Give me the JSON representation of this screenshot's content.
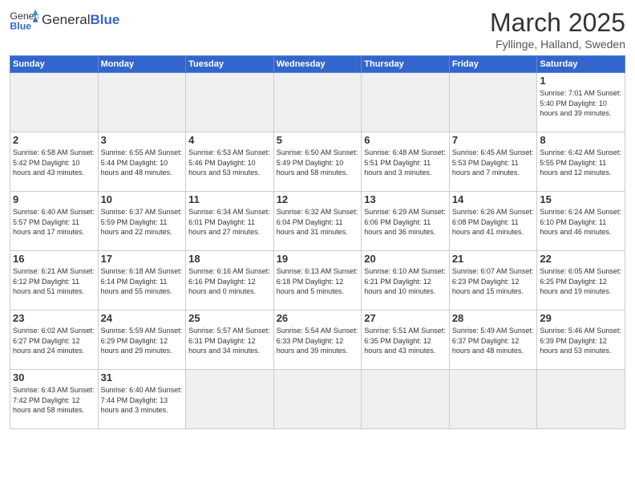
{
  "header": {
    "logo_general": "General",
    "logo_blue": "Blue",
    "month_title": "March 2025",
    "location": "Fyllinge, Halland, Sweden"
  },
  "days_of_week": [
    "Sunday",
    "Monday",
    "Tuesday",
    "Wednesday",
    "Thursday",
    "Friday",
    "Saturday"
  ],
  "weeks": [
    [
      {
        "day": "",
        "info": ""
      },
      {
        "day": "",
        "info": ""
      },
      {
        "day": "",
        "info": ""
      },
      {
        "day": "",
        "info": ""
      },
      {
        "day": "",
        "info": ""
      },
      {
        "day": "",
        "info": ""
      },
      {
        "day": "1",
        "info": "Sunrise: 7:01 AM\nSunset: 5:40 PM\nDaylight: 10 hours\nand 39 minutes."
      }
    ],
    [
      {
        "day": "2",
        "info": "Sunrise: 6:58 AM\nSunset: 5:42 PM\nDaylight: 10 hours\nand 43 minutes."
      },
      {
        "day": "3",
        "info": "Sunrise: 6:55 AM\nSunset: 5:44 PM\nDaylight: 10 hours\nand 48 minutes."
      },
      {
        "day": "4",
        "info": "Sunrise: 6:53 AM\nSunset: 5:46 PM\nDaylight: 10 hours\nand 53 minutes."
      },
      {
        "day": "5",
        "info": "Sunrise: 6:50 AM\nSunset: 5:49 PM\nDaylight: 10 hours\nand 58 minutes."
      },
      {
        "day": "6",
        "info": "Sunrise: 6:48 AM\nSunset: 5:51 PM\nDaylight: 11 hours\nand 3 minutes."
      },
      {
        "day": "7",
        "info": "Sunrise: 6:45 AM\nSunset: 5:53 PM\nDaylight: 11 hours\nand 7 minutes."
      },
      {
        "day": "8",
        "info": "Sunrise: 6:42 AM\nSunset: 5:55 PM\nDaylight: 11 hours\nand 12 minutes."
      }
    ],
    [
      {
        "day": "9",
        "info": "Sunrise: 6:40 AM\nSunset: 5:57 PM\nDaylight: 11 hours\nand 17 minutes."
      },
      {
        "day": "10",
        "info": "Sunrise: 6:37 AM\nSunset: 5:59 PM\nDaylight: 11 hours\nand 22 minutes."
      },
      {
        "day": "11",
        "info": "Sunrise: 6:34 AM\nSunset: 6:01 PM\nDaylight: 11 hours\nand 27 minutes."
      },
      {
        "day": "12",
        "info": "Sunrise: 6:32 AM\nSunset: 6:04 PM\nDaylight: 11 hours\nand 31 minutes."
      },
      {
        "day": "13",
        "info": "Sunrise: 6:29 AM\nSunset: 6:06 PM\nDaylight: 11 hours\nand 36 minutes."
      },
      {
        "day": "14",
        "info": "Sunrise: 6:26 AM\nSunset: 6:08 PM\nDaylight: 11 hours\nand 41 minutes."
      },
      {
        "day": "15",
        "info": "Sunrise: 6:24 AM\nSunset: 6:10 PM\nDaylight: 11 hours\nand 46 minutes."
      }
    ],
    [
      {
        "day": "16",
        "info": "Sunrise: 6:21 AM\nSunset: 6:12 PM\nDaylight: 11 hours\nand 51 minutes."
      },
      {
        "day": "17",
        "info": "Sunrise: 6:18 AM\nSunset: 6:14 PM\nDaylight: 11 hours\nand 55 minutes."
      },
      {
        "day": "18",
        "info": "Sunrise: 6:16 AM\nSunset: 6:16 PM\nDaylight: 12 hours\nand 0 minutes."
      },
      {
        "day": "19",
        "info": "Sunrise: 6:13 AM\nSunset: 6:18 PM\nDaylight: 12 hours\nand 5 minutes."
      },
      {
        "day": "20",
        "info": "Sunrise: 6:10 AM\nSunset: 6:21 PM\nDaylight: 12 hours\nand 10 minutes."
      },
      {
        "day": "21",
        "info": "Sunrise: 6:07 AM\nSunset: 6:23 PM\nDaylight: 12 hours\nand 15 minutes."
      },
      {
        "day": "22",
        "info": "Sunrise: 6:05 AM\nSunset: 6:25 PM\nDaylight: 12 hours\nand 19 minutes."
      }
    ],
    [
      {
        "day": "23",
        "info": "Sunrise: 6:02 AM\nSunset: 6:27 PM\nDaylight: 12 hours\nand 24 minutes."
      },
      {
        "day": "24",
        "info": "Sunrise: 5:59 AM\nSunset: 6:29 PM\nDaylight: 12 hours\nand 29 minutes."
      },
      {
        "day": "25",
        "info": "Sunrise: 5:57 AM\nSunset: 6:31 PM\nDaylight: 12 hours\nand 34 minutes."
      },
      {
        "day": "26",
        "info": "Sunrise: 5:54 AM\nSunset: 6:33 PM\nDaylight: 12 hours\nand 39 minutes."
      },
      {
        "day": "27",
        "info": "Sunrise: 5:51 AM\nSunset: 6:35 PM\nDaylight: 12 hours\nand 43 minutes."
      },
      {
        "day": "28",
        "info": "Sunrise: 5:49 AM\nSunset: 6:37 PM\nDaylight: 12 hours\nand 48 minutes."
      },
      {
        "day": "29",
        "info": "Sunrise: 5:46 AM\nSunset: 6:39 PM\nDaylight: 12 hours\nand 53 minutes."
      }
    ],
    [
      {
        "day": "30",
        "info": "Sunrise: 6:43 AM\nSunset: 7:42 PM\nDaylight: 12 hours\nand 58 minutes."
      },
      {
        "day": "31",
        "info": "Sunrise: 6:40 AM\nSunset: 7:44 PM\nDaylight: 13 hours\nand 3 minutes."
      },
      {
        "day": "",
        "info": ""
      },
      {
        "day": "",
        "info": ""
      },
      {
        "day": "",
        "info": ""
      },
      {
        "day": "",
        "info": ""
      },
      {
        "day": "",
        "info": ""
      }
    ]
  ]
}
